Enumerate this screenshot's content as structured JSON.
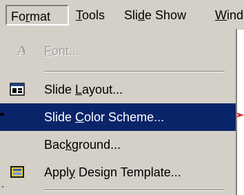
{
  "menubar": {
    "items": [
      {
        "pre": "Fo",
        "key": "r",
        "post": "mat"
      },
      {
        "pre": "",
        "key": "T",
        "post": "ools"
      },
      {
        "pre": "Sli",
        "key": "d",
        "post": "e Show"
      },
      {
        "pre": "",
        "key": "W",
        "post": "indo"
      }
    ]
  },
  "menu": {
    "font": {
      "pre": "",
      "key": "F",
      "post": "ont...",
      "icon": "font-a-icon",
      "enabled": false
    },
    "slide_layout": {
      "pre": "Slide ",
      "key": "L",
      "post": "ayout...",
      "icon": "slide-layout-icon"
    },
    "color_scheme": {
      "pre": "Slide ",
      "key": "C",
      "post": "olor Scheme...",
      "selected": true
    },
    "background": {
      "pre": "Bac",
      "key": "k",
      "post": "ground..."
    },
    "design_template": {
      "pre": "Appl",
      "key": "y",
      "post": " Design Template...",
      "icon": "design-template-icon"
    }
  },
  "colors": {
    "menu_bg": "#d4d0c8",
    "highlight": "#0a246a",
    "disabled": "#a0a0a0",
    "annotation": "#e02020"
  }
}
